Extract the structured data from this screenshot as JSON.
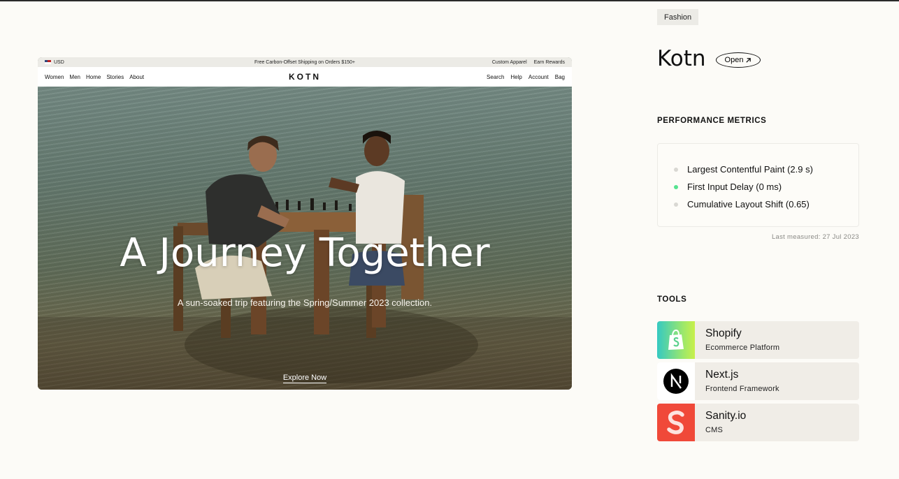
{
  "preview": {
    "announcement": {
      "currency": "USD",
      "center_text": "Free Carbon-Offset Shipping on Orders $150+",
      "right_links": [
        "Custom Apparel",
        "Earn Rewards"
      ]
    },
    "nav": {
      "left_links": [
        "Women",
        "Men",
        "Home",
        "Stories",
        "About"
      ],
      "logo": "KOTN",
      "right_links": [
        "Search",
        "Help",
        "Account",
        "Bag"
      ]
    },
    "hero": {
      "title": "A Journey Together",
      "subtitle": "A sun-soaked trip featuring the Spring/Summer 2023 collection.",
      "cta": "Explore Now"
    }
  },
  "info": {
    "tag": "Fashion",
    "title": "Kotn",
    "open_label": "Open",
    "open_icon": "arrow-up-right-icon"
  },
  "metrics": {
    "heading": "PERFORMANCE METRICS",
    "items": [
      {
        "label": "Largest Contentful Paint (2.9 s)",
        "status_color": "#d9d8d3"
      },
      {
        "label": "First Input Delay (0 ms)",
        "status_color": "#55e38f"
      },
      {
        "label": "Cumulative Layout Shift (0.65)",
        "status_color": "#d9d8d3"
      }
    ],
    "last_measured": "Last measured: 27 Jul 2023"
  },
  "tools": {
    "heading": "TOOLS",
    "items": [
      {
        "name": "Shopify",
        "category": "Ecommerce Platform",
        "icon": "shopify-icon"
      },
      {
        "name": "Next.js",
        "category": "Frontend Framework",
        "icon": "nextjs-icon"
      },
      {
        "name": "Sanity.io",
        "category": "CMS",
        "icon": "sanity-icon"
      }
    ]
  },
  "colors": {
    "background": "#fcfbf7",
    "chip": "#ecebe6",
    "tool_card": "#f0ede7",
    "sanity": "#f04939",
    "shopify_gradient": [
      "#35c9c2",
      "#c8f04a"
    ]
  }
}
